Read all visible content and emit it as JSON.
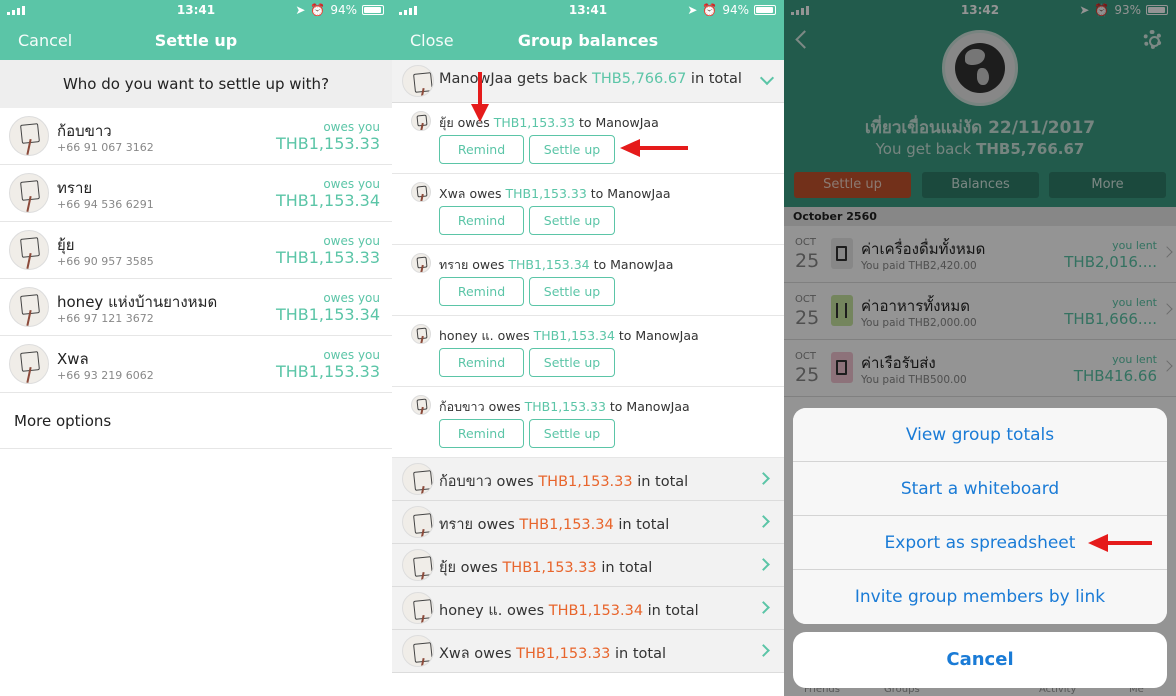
{
  "status": [
    {
      "time": "13:41",
      "battery": "94%"
    },
    {
      "time": "13:41",
      "battery": "94%"
    },
    {
      "time": "13:42",
      "battery": "93%"
    }
  ],
  "settle_up": {
    "nav": {
      "left": "Cancel",
      "title": "Settle up"
    },
    "question": "Who do you want to settle up with?",
    "members": [
      {
        "name": "ก้อบขาว",
        "phone": "+66 91 067 3162",
        "status": "owes you",
        "amount": "THB1,153.33"
      },
      {
        "name": "ทราย",
        "phone": "+66 94 536 6291",
        "status": "owes you",
        "amount": "THB1,153.34"
      },
      {
        "name": "ยุ้ย",
        "phone": "+66 90 957 3585",
        "status": "owes you",
        "amount": "THB1,153.33"
      },
      {
        "name": "honey แห่งบ้านยางหมด",
        "phone": "+66 97 121 3672",
        "status": "owes you",
        "amount": "THB1,153.34"
      },
      {
        "name": "Xwล",
        "phone": "+66 93 219 6062",
        "status": "owes you",
        "amount": "THB1,153.33"
      }
    ],
    "more_options": "More options"
  },
  "group_balances": {
    "nav": {
      "left": "Close",
      "title": "Group balances"
    },
    "head": {
      "name": "ManowJaa",
      "verb": "gets back",
      "amount": "THB5,766.67",
      "suffix": "in total"
    },
    "debts": [
      {
        "from": "ยุ้ย",
        "verb": "owes",
        "amount": "THB1,153.33",
        "to": "to ManowJaa"
      },
      {
        "from": "Xwล",
        "verb": "owes",
        "amount": "THB1,153.33",
        "to": "to ManowJaa"
      },
      {
        "from": "ทราย",
        "verb": "owes",
        "amount": "THB1,153.34",
        "to": "to ManowJaa"
      },
      {
        "from": "honey แ.",
        "verb": "owes",
        "amount": "THB1,153.34",
        "to": "to ManowJaa"
      },
      {
        "from": "ก้อบขาว",
        "verb": "owes",
        "amount": "THB1,153.33",
        "to": "to ManowJaa"
      }
    ],
    "remind_label": "Remind",
    "settle_label": "Settle up",
    "totals": [
      {
        "name": "ก้อบขาว",
        "verb": "owes",
        "amount": "THB1,153.33",
        "suffix": "in total"
      },
      {
        "name": "ทราย",
        "verb": "owes",
        "amount": "THB1,153.34",
        "suffix": "in total"
      },
      {
        "name": "ยุ้ย",
        "verb": "owes",
        "amount": "THB1,153.33",
        "suffix": "in total"
      },
      {
        "name": "honey แ.",
        "verb": "owes",
        "amount": "THB1,153.34",
        "suffix": "in total"
      },
      {
        "name": "Xwล",
        "verb": "owes",
        "amount": "THB1,153.33",
        "suffix": "in total"
      }
    ]
  },
  "group_detail": {
    "title": "เที่ยวเขื่อนแม่งัด 22/11/2017",
    "subtitle_prefix": "You get back",
    "subtitle_amount": "THB5,766.67",
    "buttons": {
      "settle": "Settle up",
      "balances": "Balances",
      "more": "More"
    },
    "month": "October 2560",
    "expenses": [
      {
        "mon": "OCT",
        "day": "25",
        "desc": "ค่าเครื่องดื่มทั้งหมด",
        "paid": "You paid THB2,420.00",
        "lent_label": "you lent",
        "lent_amount": "THB2,016....",
        "cat_color": "#e9e9e9"
      },
      {
        "mon": "OCT",
        "day": "25",
        "desc": "ค่าอาหารทั้งหมด",
        "paid": "You paid THB2,000.00",
        "lent_label": "you lent",
        "lent_amount": "THB1,666....",
        "cat_color": "#c8e6a0"
      },
      {
        "mon": "OCT",
        "day": "25",
        "desc": "ค่าเรือรับส่ง",
        "paid": "You paid THB500.00",
        "lent_label": "you lent",
        "lent_amount": "THB416.66",
        "cat_color": "#f3c5d2"
      }
    ],
    "sheet": [
      "View group totals",
      "Start a whiteboard",
      "Export as spreadsheet",
      "Invite group members by link"
    ],
    "cancel": "Cancel",
    "tabs": [
      "Friends",
      "Groups",
      "Activity",
      "Me"
    ]
  },
  "colors": {
    "accent": "#5bc5a7",
    "owe": "#e8652c",
    "link": "#1a7bd6",
    "arrow": "#e51b1b"
  }
}
